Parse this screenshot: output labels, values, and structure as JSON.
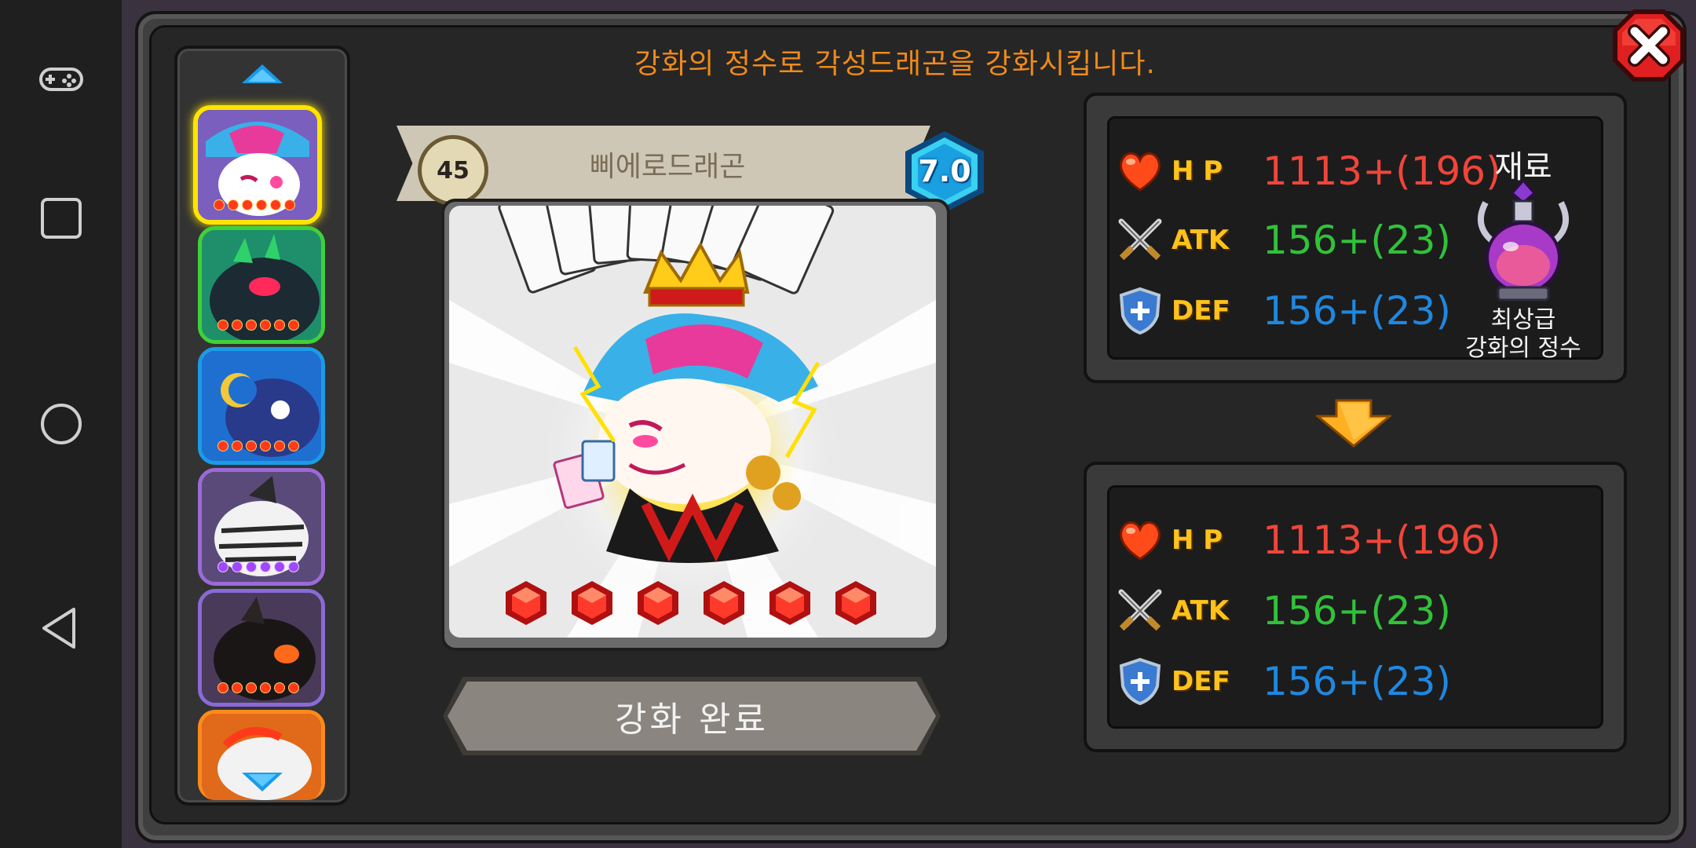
{
  "title": "강화의 정수로 각성드래곤을 강화시킵니다.",
  "dragon": {
    "name": "삐에로드래곤",
    "level": "45",
    "grade": "7.0"
  },
  "complete_button": "강화 완료",
  "stats_before": {
    "hp_label": "H P",
    "hp_value": "1113+(196)",
    "atk_label": "ATK",
    "atk_value": "156+(23)",
    "def_label": "DEF",
    "def_value": "156+(23)"
  },
  "stats_after": {
    "hp_label": "H P",
    "hp_value": "1113+(196)",
    "atk_label": "ATK",
    "atk_value": "156+(23)",
    "def_label": "DEF",
    "def_value": "156+(23)"
  },
  "material": {
    "title": "재료",
    "name_line1": "최상급",
    "name_line2": "강화의 정수"
  },
  "dragon_list": [
    {
      "id": "pierrot-dragon",
      "stars": 6,
      "star_color": "#ff3a1a",
      "selected": true
    },
    {
      "id": "dark-green-dragon",
      "stars": 6,
      "star_color": "#ff3a1a"
    },
    {
      "id": "blue-moon-dragon",
      "stars": 6,
      "star_color": "#ff3a1a"
    },
    {
      "id": "mummy-dragon",
      "stars": 6,
      "star_color": "#a048ff"
    },
    {
      "id": "black-fire-dragon",
      "stars": 6,
      "star_color": "#ff3a1a"
    },
    {
      "id": "flame-dragon",
      "stars": 0,
      "star_color": "#ff3a1a"
    }
  ],
  "upgrade_gems": 6,
  "colors": {
    "title": "#f08a1a",
    "hp": "#f0453a",
    "atk": "#31c23a",
    "def": "#1f88e0",
    "stat_label": "#ffc21a"
  },
  "icons": {
    "nav": [
      "gamepad-icon",
      "square-icon",
      "circle-icon",
      "back-triangle-icon"
    ],
    "close": "close-x-icon",
    "hp": "heart-icon",
    "atk": "crossed-swords-icon",
    "def": "shield-icon",
    "material": "essence-potion-icon",
    "arrow": "down-arrow-icon"
  }
}
